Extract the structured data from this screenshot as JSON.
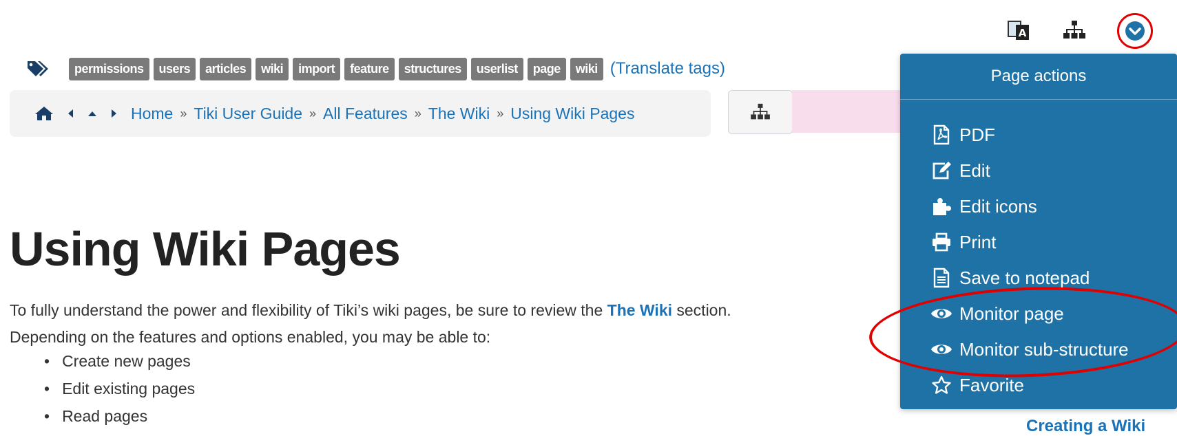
{
  "tags": {
    "items": [
      "permissions",
      "users",
      "articles",
      "wiki",
      "import",
      "feature",
      "structures",
      "userlist",
      "page",
      "wiki"
    ],
    "translate_link": "(Translate tags)"
  },
  "breadcrumb": {
    "items": [
      "Home",
      "Tiki User Guide",
      "All Features",
      "The Wiki",
      "Using Wiki Pages"
    ],
    "separator": "»"
  },
  "page": {
    "title": "Using Wiki Pages",
    "intro_before": "To fully understand the power and flexibility of Tiki’s wiki pages, be sure to review the ",
    "intro_link": "The Wiki",
    "intro_after": " section.",
    "intro_line2": "Depending on the features and options enabled, you may be able to:",
    "list": [
      "Create new pages",
      "Edit existing pages",
      "Read pages"
    ]
  },
  "page_actions": {
    "header": "Page actions",
    "items": [
      {
        "label": "PDF",
        "icon": "pdf-icon"
      },
      {
        "label": "Edit",
        "icon": "edit-icon"
      },
      {
        "label": "Edit icons",
        "icon": "puzzle-icon"
      },
      {
        "label": "Print",
        "icon": "print-icon"
      },
      {
        "label": "Save to notepad",
        "icon": "notepad-icon"
      },
      {
        "label": "Monitor page",
        "icon": "eye-icon"
      },
      {
        "label": "Monitor sub-structure",
        "icon": "eye-icon"
      },
      {
        "label": "Favorite",
        "icon": "star-icon"
      }
    ]
  },
  "footer_link": "Creating a Wiki",
  "colors": {
    "menu_bg": "#1e72a6",
    "link": "#1a73b8",
    "tag_bg": "#7a7a7a",
    "highlight": "#e00000"
  }
}
